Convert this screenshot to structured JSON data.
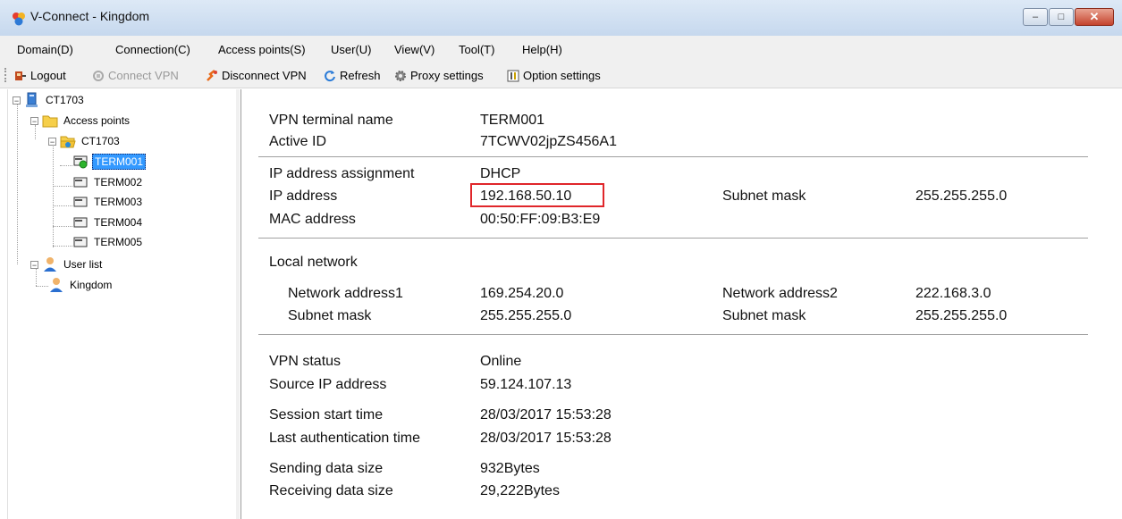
{
  "window": {
    "title": "V-Connect - Kingdom",
    "controls": {
      "minimize": "–",
      "maximize": "□",
      "close": "✕"
    }
  },
  "menu": [
    "Domain(D)",
    "Connection(C)",
    "Access points(S)",
    "User(U)",
    "View(V)",
    "Tool(T)",
    "Help(H)"
  ],
  "toolbar": {
    "logout": "Logout",
    "connect_vpn": "Connect VPN",
    "disconnect_vpn": "Disconnect VPN",
    "refresh": "Refresh",
    "proxy_settings": "Proxy settings",
    "option_settings": "Option settings"
  },
  "tree": {
    "root": "CT1703",
    "access_points": "Access points",
    "group": "CT1703",
    "terminals": [
      "TERM001",
      "TERM002",
      "TERM003",
      "TERM004",
      "TERM005"
    ],
    "selected": "TERM001",
    "user_list": "User list",
    "user": "Kingdom"
  },
  "details": {
    "terminal_name_label": "VPN terminal name",
    "terminal_name": "TERM001",
    "active_id_label": "Active ID",
    "active_id": "7TCWV02jpZS456A1",
    "ip_assignment_label": "IP address assignment",
    "ip_assignment": "DHCP",
    "ip_address_label": "IP address",
    "ip_address": "192.168.50.10",
    "subnet_mask_label": "Subnet mask",
    "subnet_mask": "255.255.255.0",
    "mac_label": "MAC address",
    "mac": "00:50:FF:09:B3:E9",
    "local_network_label": "Local network",
    "net_addr1_label": "Network address1",
    "net_addr1": "169.254.20.0",
    "net_addr2_label": "Network address2",
    "net_addr2": "222.168.3.0",
    "local_subnet1_label": "Subnet mask",
    "local_subnet1": "255.255.255.0",
    "local_subnet2_label": "Subnet mask",
    "local_subnet2": "255.255.255.0",
    "vpn_status_label": "VPN status",
    "vpn_status": "Online",
    "source_ip_label": "Source IP address",
    "source_ip": "59.124.107.13",
    "session_start_label": "Session start time",
    "session_start": "28/03/2017 15:53:28",
    "last_auth_label": "Last authentication time",
    "last_auth": "28/03/2017 15:53:28",
    "sending_label": "Sending data size",
    "sending": "932Bytes",
    "receiving_label": "Receiving data size",
    "receiving": "29,222Bytes"
  },
  "colors": {
    "selection": "#3399ff",
    "highlight_box": "#e0262a",
    "titlebar": "#c6d8ee"
  }
}
